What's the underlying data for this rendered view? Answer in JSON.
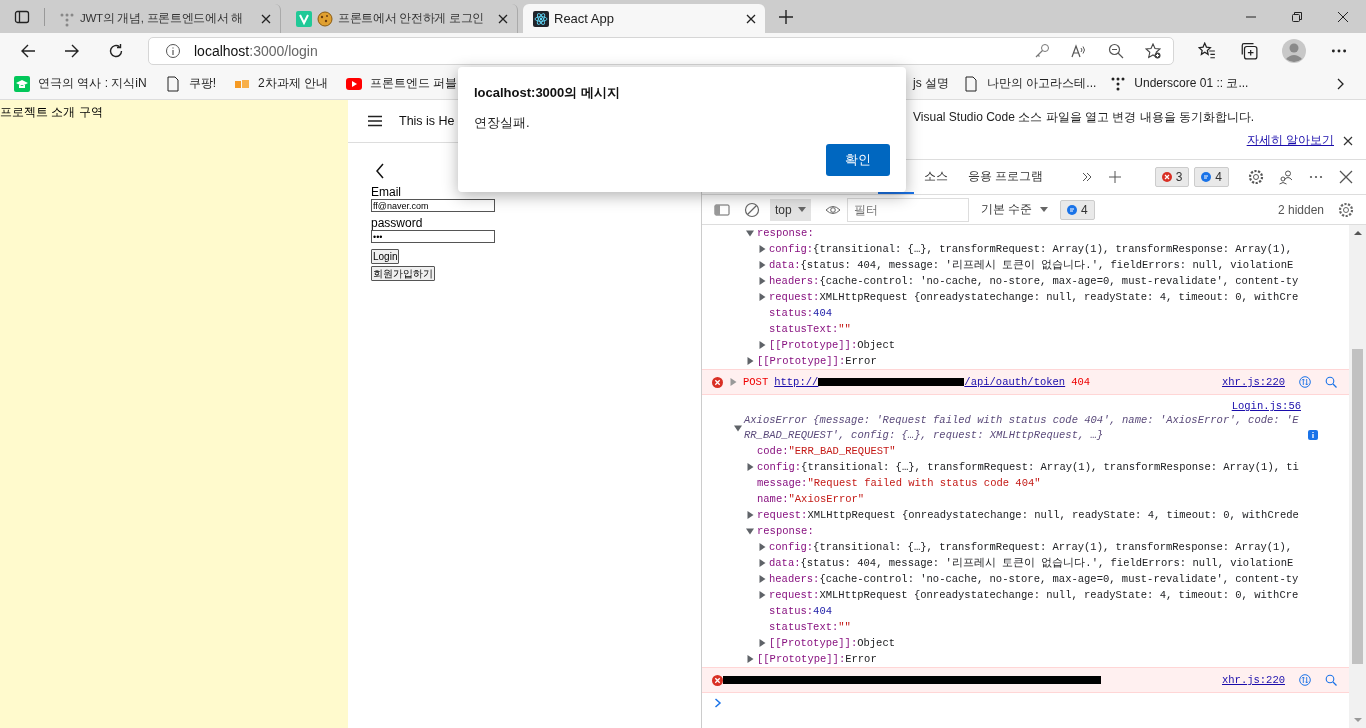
{
  "browser": {
    "tabs": [
      {
        "title": "JWT의 개념, 프론트엔드에서 해",
        "selected": false
      },
      {
        "title": "프론트에서 안전하게 로그인",
        "selected": false
      },
      {
        "title": "React App",
        "selected": true
      }
    ],
    "address": {
      "host": "localhost",
      "path": ":3000/login"
    },
    "bookmarks": [
      {
        "label": "연극의 역사 : 지식iN"
      },
      {
        "label": "쿠팡!"
      },
      {
        "label": "2차과제 안내"
      },
      {
        "label": "프론트엔드 퍼블"
      },
      {
        "label": "js 설명"
      },
      {
        "label": "나만의 아고라스테..."
      },
      {
        "label": "Underscore 01 :: 코..."
      }
    ]
  },
  "page": {
    "intro_pane": "프로젝트 소개 구역",
    "header_title": "This is He",
    "form": {
      "email_label": "Email",
      "email_value": "ff@naver.com",
      "password_label": "password",
      "password_value": "•••",
      "buttons": [
        "Login",
        "회원가입하기"
      ]
    }
  },
  "dialog": {
    "title": "localhost:3000의 메시지",
    "message": "연장실패.",
    "button": "확인"
  },
  "devtools": {
    "notice": {
      "text": "Visual Studio Code 소스 파일을 열고 변경 내용을 동기화합니다.",
      "link": "자세히 알아보기"
    },
    "tabs": [
      {
        "selected": true
      },
      {
        "label": "소스",
        "selected": false
      },
      {
        "label": "응용 프로그램",
        "selected": false
      }
    ],
    "error_count": "3",
    "message_count": "4",
    "toolbar": {
      "context": "top",
      "filter_placeholder": "필터",
      "level": "기본 수준",
      "message_count": "4",
      "hidden": "2 hidden"
    },
    "console": [
      {
        "kind": "continuation",
        "nodes": [
          {
            "kind": "branch",
            "key": "response:",
            "expanded": true,
            "children": [
              {
                "kind": "branch",
                "key": "config:",
                "value": "{transitional: {…}, transformRequest: Array(1), transformResponse: Array(1),",
                "expanded": false
              },
              {
                "kind": "branch",
                "key": "data:",
                "value": "{status: 404, message: '리프레시 토큰이 없습니다.', fieldErrors: null, violationE",
                "expanded": false
              },
              {
                "kind": "branch",
                "key": "headers:",
                "value": "{cache-control: 'no-cache, no-store, max-age=0, must-revalidate', content-ty",
                "expanded": false
              },
              {
                "kind": "branch",
                "key": "request:",
                "value": "XMLHttpRequest {onreadystatechange: null, readyState: 4, timeout: 0, withCre",
                "expanded": false
              },
              {
                "kind": "number",
                "key": "status:",
                "value": "404"
              },
              {
                "kind": "string",
                "key": "statusText:",
                "value": "\"\""
              },
              {
                "kind": "branch",
                "key": "[[Prototype]]:",
                "value": "Object",
                "expanded": false
              }
            ]
          },
          {
            "kind": "branch",
            "key": "[[Prototype]]:",
            "value": "Error",
            "expanded": false
          }
        ]
      },
      {
        "kind": "error",
        "method": "POST",
        "url_start": "http://",
        "url_end": "/api/oauth/token",
        "status": "404",
        "source": "xhr.js:220"
      },
      {
        "kind": "log",
        "source": "Login.js:56",
        "summary": "AxiosError {message: 'Request failed with status code 404', name: 'AxiosError', code: 'ERR_BAD_REQUEST', config: {…}, request: XMLHttpRequest, …}",
        "expanded": true,
        "children": [
          {
            "kind": "string",
            "key": "code:",
            "value": "\"ERR_BAD_REQUEST\""
          },
          {
            "kind": "branch",
            "key": "config:",
            "value": "{transitional: {…}, transformRequest: Array(1), transformResponse: Array(1), ti",
            "expanded": false
          },
          {
            "kind": "string",
            "key": "message:",
            "value": "\"Request failed with status code 404\""
          },
          {
            "kind": "string",
            "key": "name:",
            "value": "\"AxiosError\""
          },
          {
            "kind": "branch",
            "key": "request:",
            "value": "XMLHttpRequest {onreadystatechange: null, readyState: 4, timeout: 0, withCrede",
            "expanded": false
          },
          {
            "kind": "branch",
            "key": "response:",
            "expanded": true,
            "children": [
              {
                "kind": "branch",
                "key": "config:",
                "value": "{transitional: {…}, transformRequest: Array(1), transformResponse: Array(1),",
                "expanded": false
              },
              {
                "kind": "branch",
                "key": "data:",
                "value": "{status: 404, message: '리프레시 토큰이 없습니다.', fieldErrors: null, violationE",
                "expanded": false
              },
              {
                "kind": "branch",
                "key": "headers:",
                "value": "{cache-control: 'no-cache, no-store, max-age=0, must-revalidate', content-ty",
                "expanded": false
              },
              {
                "kind": "branch",
                "key": "request:",
                "value": "XMLHttpRequest {onreadystatechange: null, readyState: 4, timeout: 0, withCre",
                "expanded": false
              },
              {
                "kind": "number",
                "key": "status:",
                "value": "404"
              },
              {
                "kind": "string",
                "key": "statusText:",
                "value": "\"\""
              },
              {
                "kind": "branch",
                "key": "[[Prototype]]:",
                "value": "Object",
                "expanded": false
              }
            ]
          },
          {
            "kind": "branch",
            "key": "[[Prototype]]:",
            "value": "Error",
            "expanded": false
          }
        ]
      },
      {
        "kind": "redacted_error",
        "source": "xhr.js:220"
      }
    ]
  }
}
